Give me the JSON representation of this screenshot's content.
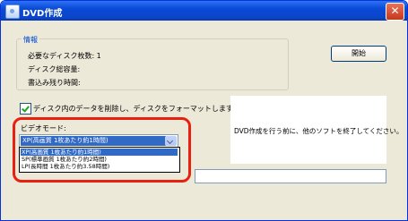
{
  "window": {
    "title": "DVD作成",
    "close_glyph": "✕"
  },
  "info": {
    "legend": "情報",
    "required_discs": "必要なディスク枚数: 1",
    "disc_capacity": "ディスク総容量:",
    "time_remaining": "書込み残り時間:"
  },
  "start_button": "開始",
  "format_checkbox": {
    "label": "ディスク内のデータを削除し、ディスクをフォーマットします。",
    "checked": true
  },
  "video_mode": {
    "label": "ビデオモード:",
    "selected": "XP(高画質 1枚あたり約1時間)",
    "options": [
      "XP(高画質 1枚あたり約1時間)",
      "SP(標準画質 1枚あたり約2時間)",
      "LP(長時間 1枚あたり約3.58時間)"
    ]
  },
  "message": "DVD作成を行う前に、他のソフトを終了してください。",
  "colors": {
    "highlight": "#e82010",
    "selection": "#316ac5",
    "titlebar": "#0a4ad6"
  }
}
